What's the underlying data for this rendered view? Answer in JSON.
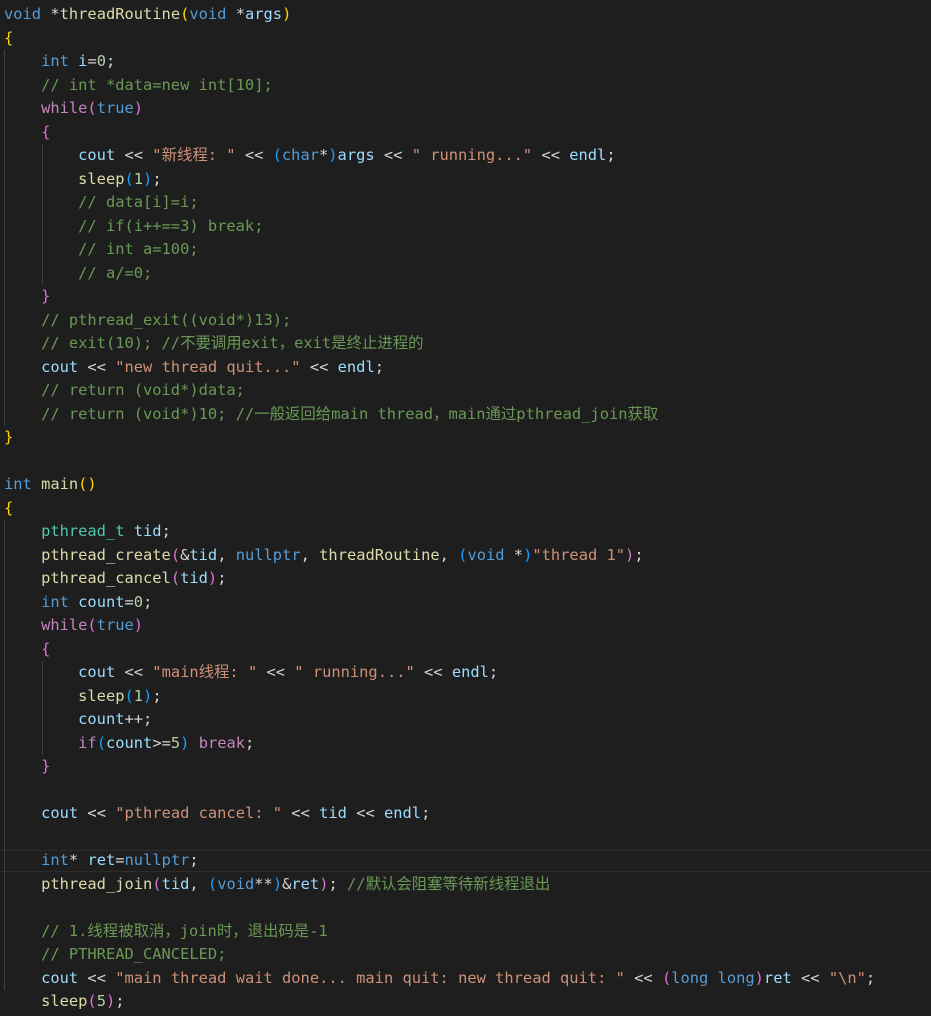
{
  "editor": {
    "lines": [
      [
        [
          "kw",
          "void "
        ],
        [
          "pl",
          "*"
        ],
        [
          "fn",
          "threadRoutine"
        ],
        [
          "b1",
          "("
        ],
        [
          "kw",
          "void "
        ],
        [
          "pl",
          "*"
        ],
        [
          "var",
          "args"
        ],
        [
          "b1",
          ")"
        ]
      ],
      [
        [
          "b1",
          "{"
        ]
      ],
      [
        [
          "pl",
          "    "
        ],
        [
          "kw",
          "int "
        ],
        [
          "var",
          "i"
        ],
        [
          "pl",
          "="
        ],
        [
          "num",
          "0"
        ],
        [
          "pl",
          ";"
        ]
      ],
      [
        [
          "pl",
          "    "
        ],
        [
          "cm",
          "// int *data=new int[10];"
        ]
      ],
      [
        [
          "pl",
          "    "
        ],
        [
          "ctl",
          "while"
        ],
        [
          "b2",
          "("
        ],
        [
          "kw",
          "true"
        ],
        [
          "b2",
          ")"
        ]
      ],
      [
        [
          "pl",
          "    "
        ],
        [
          "b2",
          "{"
        ]
      ],
      [
        [
          "pl",
          "        "
        ],
        [
          "var",
          "cout "
        ],
        [
          "pl",
          "<< "
        ],
        [
          "str",
          "\"新线程: \" "
        ],
        [
          "pl",
          "<< "
        ],
        [
          "b3",
          "("
        ],
        [
          "kw",
          "char"
        ],
        [
          "pl",
          "*"
        ],
        [
          "b3",
          ")"
        ],
        [
          "var",
          "args "
        ],
        [
          "pl",
          "<< "
        ],
        [
          "str",
          "\" running...\" "
        ],
        [
          "pl",
          "<< "
        ],
        [
          "var",
          "endl"
        ],
        [
          "pl",
          ";"
        ]
      ],
      [
        [
          "pl",
          "        "
        ],
        [
          "fn",
          "sleep"
        ],
        [
          "b3",
          "("
        ],
        [
          "num",
          "1"
        ],
        [
          "b3",
          ")"
        ],
        [
          "pl",
          ";"
        ]
      ],
      [
        [
          "pl",
          "        "
        ],
        [
          "cm",
          "// data[i]=i;"
        ]
      ],
      [
        [
          "pl",
          "        "
        ],
        [
          "cm",
          "// if(i++==3) break;"
        ]
      ],
      [
        [
          "pl",
          "        "
        ],
        [
          "cm",
          "// int a=100;"
        ]
      ],
      [
        [
          "pl",
          "        "
        ],
        [
          "cm",
          "// a/=0;"
        ]
      ],
      [
        [
          "pl",
          "    "
        ],
        [
          "b2",
          "}"
        ]
      ],
      [
        [
          "pl",
          "    "
        ],
        [
          "cm",
          "// pthread_exit((void*)13);"
        ]
      ],
      [
        [
          "pl",
          "    "
        ],
        [
          "cm",
          "// exit(10); //不要调用exit，exit是终止进程的"
        ]
      ],
      [
        [
          "pl",
          "    "
        ],
        [
          "var",
          "cout "
        ],
        [
          "pl",
          "<< "
        ],
        [
          "str",
          "\"new thread quit...\" "
        ],
        [
          "pl",
          "<< "
        ],
        [
          "var",
          "endl"
        ],
        [
          "pl",
          ";"
        ]
      ],
      [
        [
          "pl",
          "    "
        ],
        [
          "cm",
          "// return (void*)data;"
        ]
      ],
      [
        [
          "pl",
          "    "
        ],
        [
          "cm",
          "// return (void*)10; //一般返回给main thread，main通过pthread_join获取"
        ]
      ],
      [
        [
          "b1",
          "}"
        ]
      ],
      [],
      [
        [
          "kw",
          "int "
        ],
        [
          "fn",
          "main"
        ],
        [
          "b1",
          "()"
        ]
      ],
      [
        [
          "b1",
          "{"
        ]
      ],
      [
        [
          "pl",
          "    "
        ],
        [
          "ty",
          "pthread_t "
        ],
        [
          "var",
          "tid"
        ],
        [
          "pl",
          ";"
        ]
      ],
      [
        [
          "pl",
          "    "
        ],
        [
          "fn",
          "pthread_create"
        ],
        [
          "b2",
          "("
        ],
        [
          "pl",
          "&"
        ],
        [
          "var",
          "tid"
        ],
        [
          "pl",
          ", "
        ],
        [
          "kw",
          "nullptr"
        ],
        [
          "pl",
          ", "
        ],
        [
          "fn",
          "threadRoutine"
        ],
        [
          "pl",
          ", "
        ],
        [
          "b3",
          "("
        ],
        [
          "kw",
          "void "
        ],
        [
          "pl",
          "*"
        ],
        [
          "b3",
          ")"
        ],
        [
          "str",
          "\"thread 1\""
        ],
        [
          "b2",
          ")"
        ],
        [
          "pl",
          ";"
        ]
      ],
      [
        [
          "pl",
          "    "
        ],
        [
          "fn",
          "pthread_cancel"
        ],
        [
          "b2",
          "("
        ],
        [
          "var",
          "tid"
        ],
        [
          "b2",
          ")"
        ],
        [
          "pl",
          ";"
        ]
      ],
      [
        [
          "pl",
          "    "
        ],
        [
          "kw",
          "int "
        ],
        [
          "var",
          "count"
        ],
        [
          "pl",
          "="
        ],
        [
          "num",
          "0"
        ],
        [
          "pl",
          ";"
        ]
      ],
      [
        [
          "pl",
          "    "
        ],
        [
          "ctl",
          "while"
        ],
        [
          "b2",
          "("
        ],
        [
          "kw",
          "true"
        ],
        [
          "b2",
          ")"
        ]
      ],
      [
        [
          "pl",
          "    "
        ],
        [
          "b2",
          "{"
        ]
      ],
      [
        [
          "pl",
          "        "
        ],
        [
          "var",
          "cout "
        ],
        [
          "pl",
          "<< "
        ],
        [
          "str",
          "\"main线程: \" "
        ],
        [
          "pl",
          "<< "
        ],
        [
          "str",
          "\" running...\" "
        ],
        [
          "pl",
          "<< "
        ],
        [
          "var",
          "endl"
        ],
        [
          "pl",
          ";"
        ]
      ],
      [
        [
          "pl",
          "        "
        ],
        [
          "fn",
          "sleep"
        ],
        [
          "b3",
          "("
        ],
        [
          "num",
          "1"
        ],
        [
          "b3",
          ")"
        ],
        [
          "pl",
          ";"
        ]
      ],
      [
        [
          "pl",
          "        "
        ],
        [
          "var",
          "count"
        ],
        [
          "pl",
          "++;"
        ]
      ],
      [
        [
          "pl",
          "        "
        ],
        [
          "ctl",
          "if"
        ],
        [
          "b3",
          "("
        ],
        [
          "var",
          "count"
        ],
        [
          "pl",
          ">="
        ],
        [
          "num",
          "5"
        ],
        [
          "b3",
          ")"
        ],
        [
          "pl",
          " "
        ],
        [
          "ctl",
          "break"
        ],
        [
          "pl",
          ";"
        ]
      ],
      [
        [
          "pl",
          "    "
        ],
        [
          "b2",
          "}"
        ]
      ],
      [],
      [
        [
          "pl",
          "    "
        ],
        [
          "var",
          "cout "
        ],
        [
          "pl",
          "<< "
        ],
        [
          "str",
          "\"pthread cancel: \" "
        ],
        [
          "pl",
          "<< "
        ],
        [
          "var",
          "tid "
        ],
        [
          "pl",
          "<< "
        ],
        [
          "var",
          "endl"
        ],
        [
          "pl",
          ";"
        ]
      ],
      [],
      [
        [
          "pl",
          "    "
        ],
        [
          "kw",
          "int"
        ],
        [
          "pl",
          "* "
        ],
        [
          "var",
          "ret"
        ],
        [
          "pl",
          "="
        ],
        [
          "kw",
          "nullptr"
        ],
        [
          "pl",
          ";"
        ]
      ],
      [
        [
          "pl",
          "    "
        ],
        [
          "fn",
          "pthread_join"
        ],
        [
          "b2",
          "("
        ],
        [
          "var",
          "tid"
        ],
        [
          "pl",
          ", "
        ],
        [
          "b3",
          "("
        ],
        [
          "kw",
          "void"
        ],
        [
          "pl",
          "**"
        ],
        [
          "b3",
          ")"
        ],
        [
          "pl",
          "&"
        ],
        [
          "var",
          "ret"
        ],
        [
          "b2",
          ")"
        ],
        [
          "pl",
          "; "
        ],
        [
          "cm",
          "//默认会阻塞等待新线程退出"
        ]
      ],
      [],
      [
        [
          "pl",
          "    "
        ],
        [
          "cm",
          "// 1.线程被取消，join时，退出码是-1"
        ]
      ],
      [
        [
          "pl",
          "    "
        ],
        [
          "cm",
          "// PTHREAD_CANCELED;"
        ]
      ],
      [
        [
          "pl",
          "    "
        ],
        [
          "var",
          "cout "
        ],
        [
          "pl",
          "<< "
        ],
        [
          "str",
          "\"main thread wait done... main quit: new thread quit: \" "
        ],
        [
          "pl",
          "<< "
        ],
        [
          "b2",
          "("
        ],
        [
          "kw",
          "long long"
        ],
        [
          "b2",
          ")"
        ],
        [
          "var",
          "ret "
        ],
        [
          "pl",
          "<< "
        ],
        [
          "str",
          "\"\\n\""
        ],
        [
          "pl",
          ";"
        ]
      ],
      [
        [
          "pl",
          "    "
        ],
        [
          "fn",
          "sleep"
        ],
        [
          "b2",
          "("
        ],
        [
          "num",
          "5"
        ],
        [
          "b2",
          ")"
        ],
        [
          "pl",
          ";"
        ]
      ]
    ]
  }
}
